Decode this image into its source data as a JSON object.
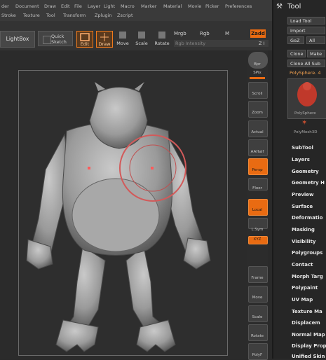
{
  "menu": [
    "der",
    "Document",
    "Draw",
    "Edit",
    "File",
    "Layer",
    "Light",
    "Macro",
    "Marker",
    "Material",
    "Movie",
    "Picker",
    "Preferences",
    "Stroke",
    "Texture",
    "Tool",
    "Transform",
    "Zplugin",
    "Zscript"
  ],
  "toolbar": {
    "lightbox": "LightBox",
    "quick_sketch_1": "Quick",
    "quick_sketch_2": "Sketch",
    "edit": "Edit",
    "draw": "Draw",
    "move": "Move",
    "scale": "Scale",
    "rotate": "Rotate",
    "mrgb": "Mrgb",
    "rgb": "Rgb",
    "m": "M",
    "zadd": "Zadd",
    "rgb_intensity": "Rgb Intensity",
    "z": "Z I"
  },
  "shelf": [
    "Bpr",
    "SPix",
    "Scroll",
    "Zoom",
    "Actual",
    "AAHalf",
    "Persp",
    "Floor",
    "Local",
    "L.Sym",
    "XYZ",
    "Frame",
    "Move",
    "Scale",
    "Rotate",
    "PolyF"
  ],
  "tool_panel": {
    "title": "Tool",
    "load_tool": "Load Tool",
    "import": "Import",
    "goz": "GoZ",
    "all": "All",
    "clone": "Clone",
    "make": "Make",
    "clone_all": "Clone All Sub",
    "current_tool": "PolySphere. 4",
    "thumb1_label": "PolySphere",
    "thumb2_label": "PolyMesh3D",
    "items": [
      "SubTool",
      "Layers",
      "Geometry",
      "Geometry H",
      "Preview",
      "Surface",
      "Deformatio",
      "Masking",
      "Visibility",
      "Polygroups",
      "Contact",
      "Morph Targ",
      "Polypaint",
      "UV Map",
      "Texture Ma",
      "Displacem",
      "Normal Map",
      "Display Prop",
      "Unified Skin"
    ]
  }
}
